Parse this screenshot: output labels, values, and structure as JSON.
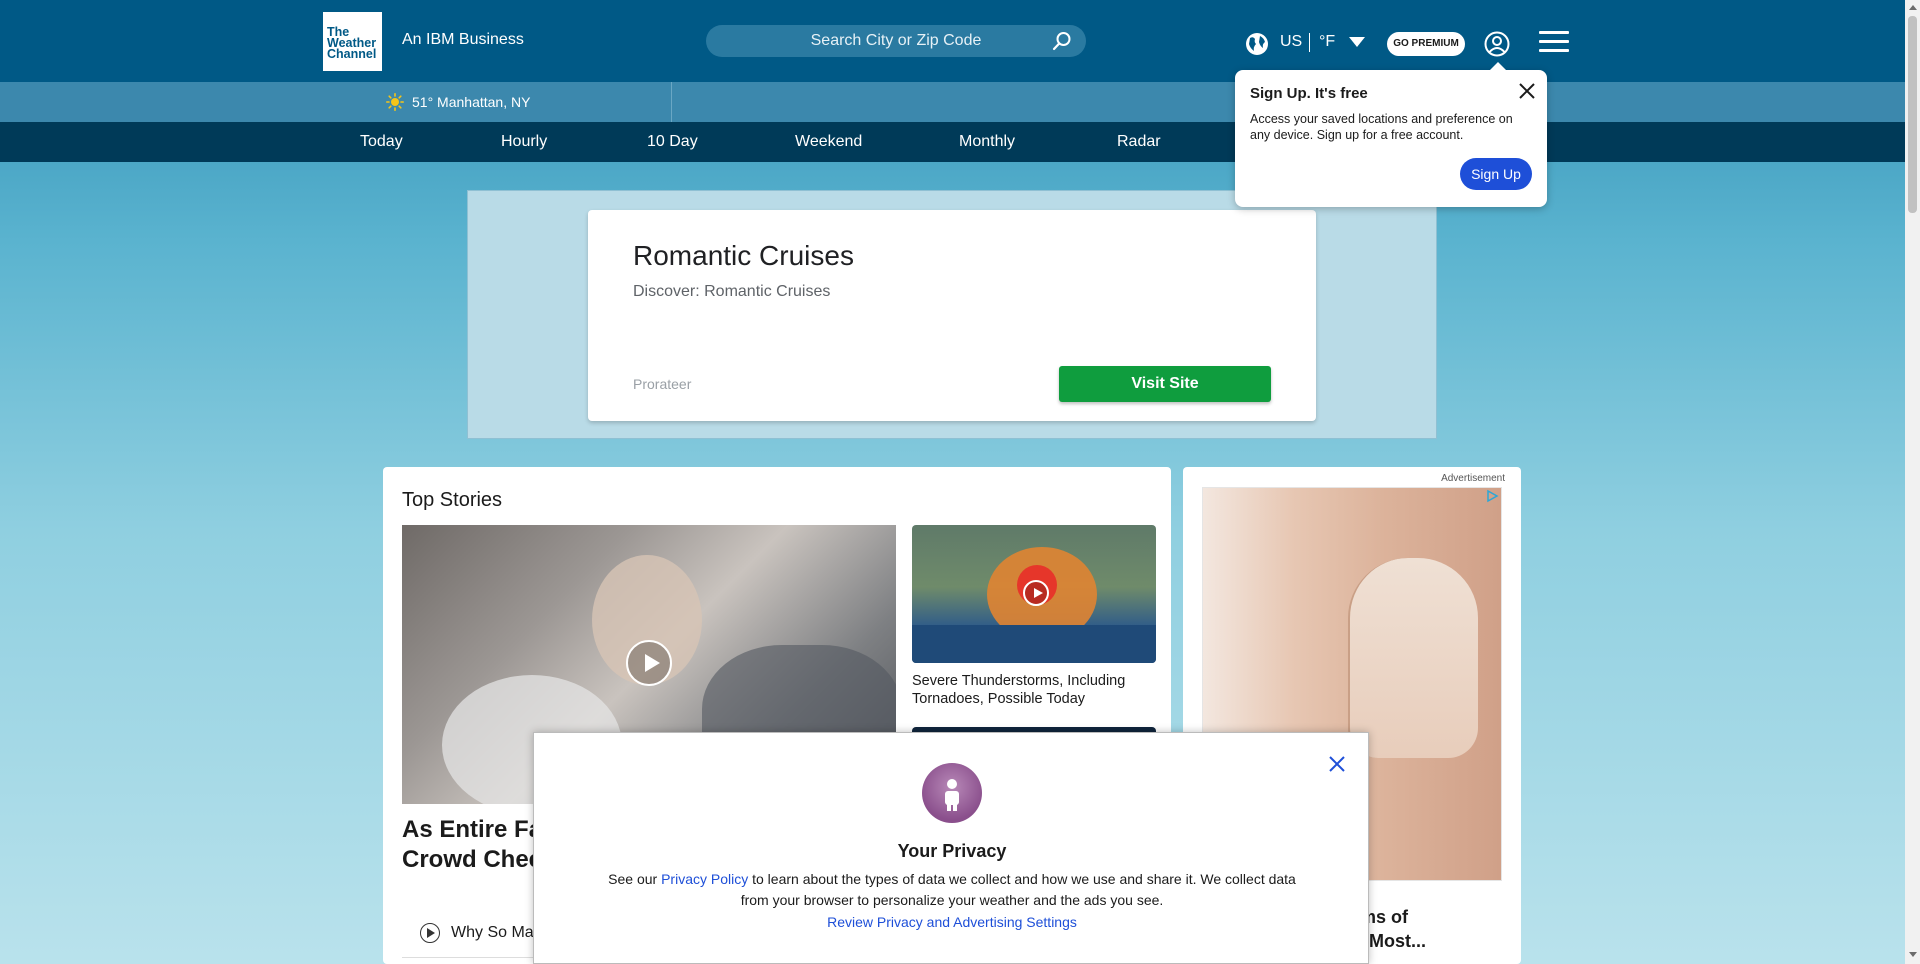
{
  "header": {
    "logo_lines": [
      "The",
      "Weather",
      "Channel"
    ],
    "tagline": "An IBM Business",
    "search_placeholder": "Search City or Zip Code",
    "country": "US",
    "unit": "°F",
    "premium_label": "GO PREMIUM",
    "icons": [
      "globe-icon",
      "search-icon",
      "chevron-down-icon",
      "user-icon",
      "menu-icon"
    ]
  },
  "location_bar": {
    "icon": "sun-icon",
    "text": "51° Manhattan, NY"
  },
  "nav": {
    "items": [
      "Today",
      "Hourly",
      "10 Day",
      "Weekend",
      "Monthly",
      "Radar"
    ]
  },
  "ad_banner": {
    "title": "Romantic Cruises",
    "subtitle": "Discover: Romantic Cruises",
    "sponsor": "Prorateer",
    "cta": "Visit Site"
  },
  "top_stories": {
    "title": "Top Stories",
    "main_headline": "As Entire Fa\nCrowd Chee",
    "sub_link": "Why So Ma",
    "side_caption": "Severe Thunderstorms, Including Tornadoes, Possible Today"
  },
  "right_ad": {
    "label": "Advertisement",
    "headline": "toms of\ntis Most..."
  },
  "signup_popup": {
    "title": "Sign Up. It's free",
    "body": "Access your saved locations and preference on any device. Sign up for a free account.",
    "button": "Sign Up"
  },
  "privacy_modal": {
    "title": "Your Privacy",
    "text_before": "See our ",
    "link": "Privacy Policy",
    "text_after": " to learn about the types of data we collect and how we use and share it. We collect data from your browser to personalize your weather and the ads you see.",
    "review_link": "Review Privacy and Advertising Settings"
  },
  "colors": {
    "header_bg": "#005986",
    "nav_bg": "#003a58",
    "accent_blue": "#1e4fd8",
    "visit_green": "#0f9d3e"
  }
}
